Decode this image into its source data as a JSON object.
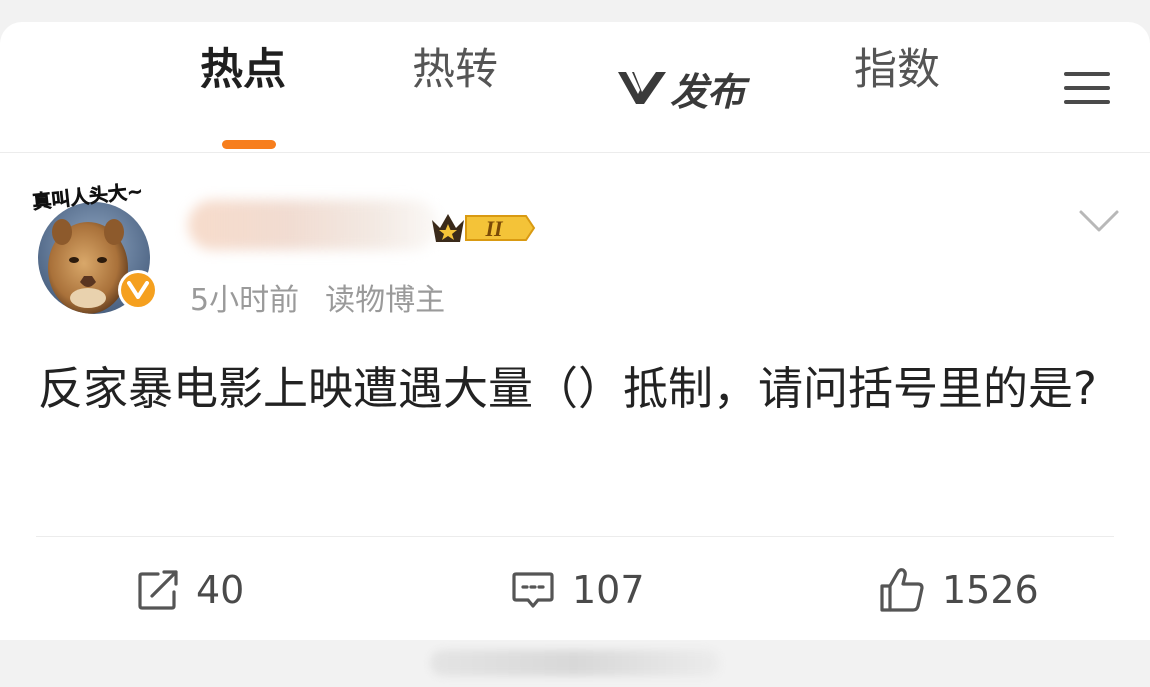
{
  "tabs": [
    {
      "label": "热点",
      "active": true
    },
    {
      "label": "热转",
      "active": false
    },
    {
      "label": "发布",
      "active": false
    },
    {
      "label": "指数",
      "active": false
    }
  ],
  "accent_color": "#f77e1d",
  "publish_logo": "V",
  "avatar": {
    "sticker_text": "真叫人头大~",
    "verified": true,
    "verify_icon": "v-badge-icon"
  },
  "user": {
    "level_badge": "II"
  },
  "post": {
    "time": "5小时前",
    "source": "读物博主",
    "text": "反家暴电影上映遭遇大量（）抵制，请问括号里的是?"
  },
  "actions": {
    "repost_count": "40",
    "comment_count": "107",
    "like_count": "1526"
  },
  "icons": {
    "menu": "hamburger-menu-icon",
    "collapse": "chevron-down-icon",
    "repost": "share-icon",
    "comment": "comment-icon",
    "like": "thumbs-up-icon"
  }
}
